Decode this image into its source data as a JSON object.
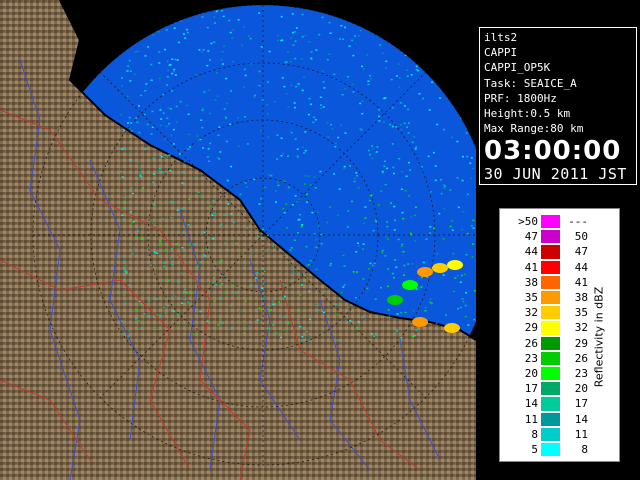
{
  "info": {
    "lines": [
      "ilts2",
      "CAPPI",
      "CAPPI_OP5K",
      "Task: SEAICE_A",
      "PRF: 1800Hz",
      "Height:0.5 km",
      "Max Range:80 km"
    ],
    "time": "03:00:00",
    "date": "30 JUN 2011 JST"
  },
  "legend": {
    "title": "Reflectivity in dBZ",
    "rows": [
      {
        "lo": ">50",
        "hi": "---",
        "color": "#ff00ff"
      },
      {
        "lo": "47",
        "hi": "50",
        "color": "#cc00cc"
      },
      {
        "lo": "44",
        "hi": "47",
        "color": "#cc0000"
      },
      {
        "lo": "41",
        "hi": "44",
        "color": "#ff0000"
      },
      {
        "lo": "38",
        "hi": "41",
        "color": "#ff6600"
      },
      {
        "lo": "35",
        "hi": "38",
        "color": "#ff9900"
      },
      {
        "lo": "32",
        "hi": "35",
        "color": "#ffcc00"
      },
      {
        "lo": "29",
        "hi": "32",
        "color": "#ffff00"
      },
      {
        "lo": "26",
        "hi": "29",
        "color": "#009900"
      },
      {
        "lo": "23",
        "hi": "26",
        "color": "#00cc00"
      },
      {
        "lo": "20",
        "hi": "23",
        "color": "#00ff00"
      },
      {
        "lo": "17",
        "hi": "20",
        "color": "#00aa66"
      },
      {
        "lo": "14",
        "hi": "17",
        "color": "#00cc99"
      },
      {
        "lo": "11",
        "hi": "14",
        "color": "#009999"
      },
      {
        "lo": "8",
        "hi": "11",
        "color": "#00cccc"
      },
      {
        "lo": "5",
        "hi": "8",
        "color": "#00ffff"
      }
    ]
  },
  "colors": {
    "sea": "#0a57dc",
    "land": "#7a6548",
    "ring": "#111111"
  }
}
